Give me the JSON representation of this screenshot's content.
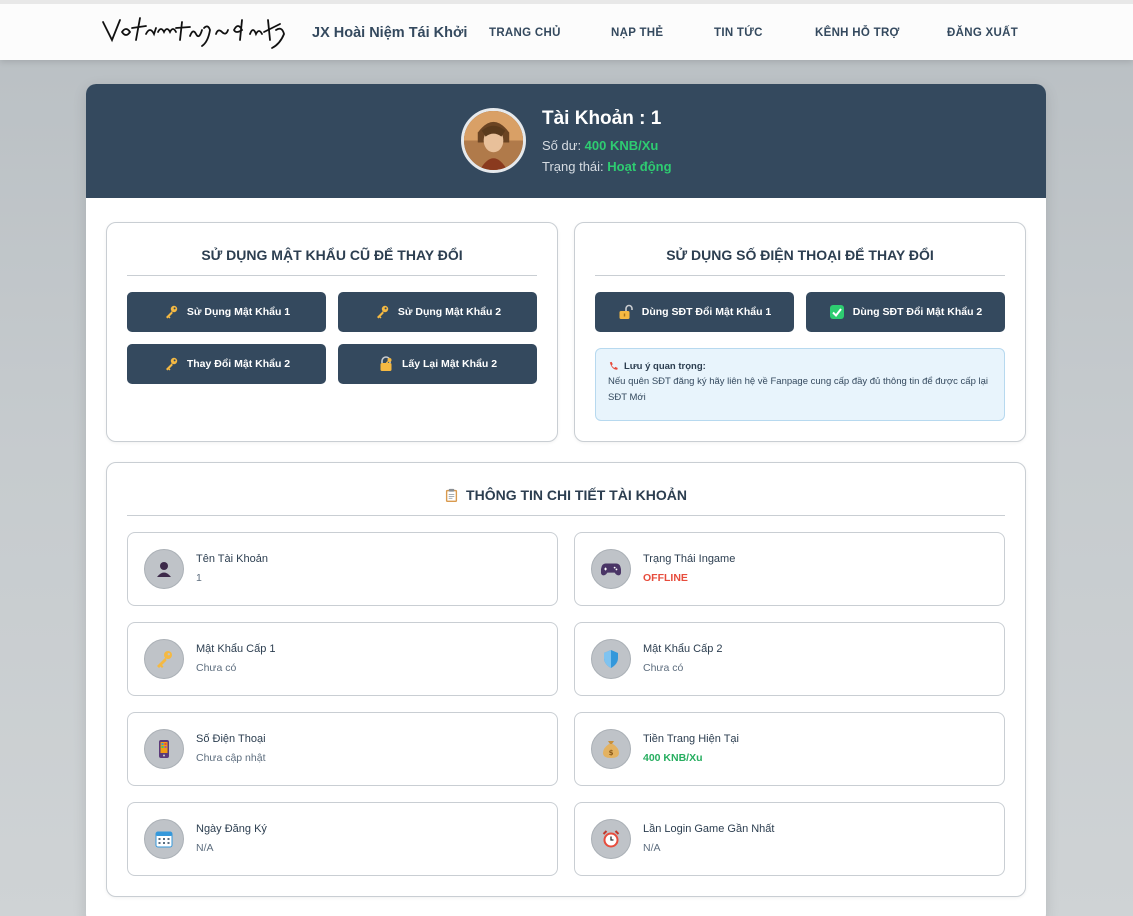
{
  "nav": {
    "brand": "JX Hoài Niệm Tái Khởi",
    "items": [
      "TRANG CHỦ",
      "NẠP THẺ",
      "TIN TỨC",
      "KÊNH HỖ TRỢ",
      "ĐĂNG XUẤT"
    ]
  },
  "profile": {
    "title": "Tài Khoản : 1",
    "balance_label": "Số dư: ",
    "balance_value": "400 KNB/Xu",
    "status_label": "Trạng thái: ",
    "status_value": "Hoạt động"
  },
  "password_panel": {
    "title": "SỬ DỤNG MẬT KHẨU CŨ ĐỂ THAY ĐỔI",
    "buttons": [
      {
        "label": "Sử Dụng Mật Khẩu 1",
        "icon": "key-icon"
      },
      {
        "label": "Sử Dụng Mật Khẩu 2",
        "icon": "key-icon"
      },
      {
        "label": "Thay Đổi Mật Khẩu 2",
        "icon": "key-icon"
      },
      {
        "label": "Lấy Lại Mật Khẩu 2",
        "icon": "lock-key-icon"
      }
    ]
  },
  "phone_panel": {
    "title": "SỬ DỤNG SỐ ĐIỆN THOẠI ĐỂ THAY ĐỔI",
    "buttons": [
      {
        "label": "Dùng SĐT Đổi Mật Khẩu 1",
        "icon": "unlock-icon"
      },
      {
        "label": "Dùng SĐT Đổi Mật Khẩu 2",
        "icon": "check-box-icon"
      }
    ],
    "note_title": "Lưu ý quan trọng:",
    "note_body": "Nếu quên SĐT đăng ký hãy liên hệ về Fanpage cung cấp đầy đủ thông tin để được cấp lại SĐT Mới"
  },
  "details": {
    "title": "THÔNG TIN CHI TIẾT TÀI KHOẢN",
    "items": [
      {
        "label": "Tên Tài Khoản",
        "value": "1",
        "icon": "user-icon"
      },
      {
        "label": "Trạng Thái Ingame",
        "value": "OFFLINE",
        "icon": "gamepad-icon"
      },
      {
        "label": "Mật Khẩu Cấp 1",
        "value": "Chưa có",
        "icon": "key-icon"
      },
      {
        "label": "Mật Khẩu Cấp 2",
        "value": "Chưa có",
        "icon": "shield-icon"
      },
      {
        "label": "Số Điện Thoại",
        "value": "Chưa cập nhật",
        "icon": "phone-icon"
      },
      {
        "label": "Tiền Trang Hiện Tại",
        "value": "400 KNB/Xu",
        "icon": "money-bag-icon"
      },
      {
        "label": "Ngày Đăng Ký",
        "value": "N/A",
        "icon": "calendar-icon"
      },
      {
        "label": "Lần Login Game Gần Nhất",
        "value": "N/A",
        "icon": "alarm-clock-icon"
      }
    ]
  },
  "colors": {
    "header_bg": "#34495e",
    "accent_green": "#2ecc71",
    "offline_red": "#e74c3c"
  }
}
